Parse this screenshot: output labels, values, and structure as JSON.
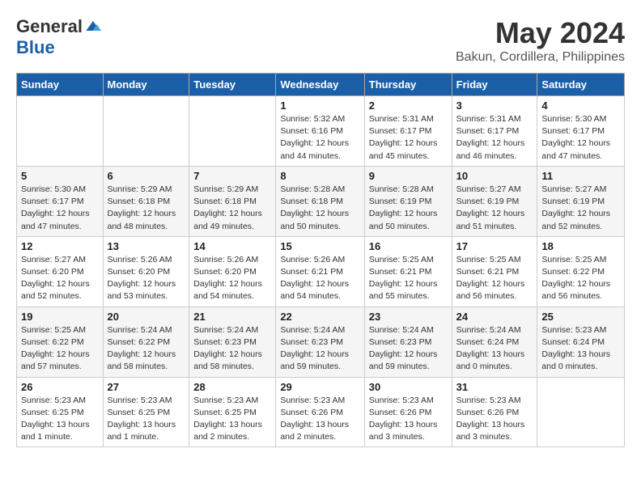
{
  "header": {
    "logo_general": "General",
    "logo_blue": "Blue",
    "title": "May 2024",
    "location": "Bakun, Cordillera, Philippines"
  },
  "weekdays": [
    "Sunday",
    "Monday",
    "Tuesday",
    "Wednesday",
    "Thursday",
    "Friday",
    "Saturday"
  ],
  "weeks": [
    [
      {
        "day": "",
        "info": ""
      },
      {
        "day": "",
        "info": ""
      },
      {
        "day": "",
        "info": ""
      },
      {
        "day": "1",
        "info": "Sunrise: 5:32 AM\nSunset: 6:16 PM\nDaylight: 12 hours\nand 44 minutes."
      },
      {
        "day": "2",
        "info": "Sunrise: 5:31 AM\nSunset: 6:17 PM\nDaylight: 12 hours\nand 45 minutes."
      },
      {
        "day": "3",
        "info": "Sunrise: 5:31 AM\nSunset: 6:17 PM\nDaylight: 12 hours\nand 46 minutes."
      },
      {
        "day": "4",
        "info": "Sunrise: 5:30 AM\nSunset: 6:17 PM\nDaylight: 12 hours\nand 47 minutes."
      }
    ],
    [
      {
        "day": "5",
        "info": "Sunrise: 5:30 AM\nSunset: 6:17 PM\nDaylight: 12 hours\nand 47 minutes."
      },
      {
        "day": "6",
        "info": "Sunrise: 5:29 AM\nSunset: 6:18 PM\nDaylight: 12 hours\nand 48 minutes."
      },
      {
        "day": "7",
        "info": "Sunrise: 5:29 AM\nSunset: 6:18 PM\nDaylight: 12 hours\nand 49 minutes."
      },
      {
        "day": "8",
        "info": "Sunrise: 5:28 AM\nSunset: 6:18 PM\nDaylight: 12 hours\nand 50 minutes."
      },
      {
        "day": "9",
        "info": "Sunrise: 5:28 AM\nSunset: 6:19 PM\nDaylight: 12 hours\nand 50 minutes."
      },
      {
        "day": "10",
        "info": "Sunrise: 5:27 AM\nSunset: 6:19 PM\nDaylight: 12 hours\nand 51 minutes."
      },
      {
        "day": "11",
        "info": "Sunrise: 5:27 AM\nSunset: 6:19 PM\nDaylight: 12 hours\nand 52 minutes."
      }
    ],
    [
      {
        "day": "12",
        "info": "Sunrise: 5:27 AM\nSunset: 6:20 PM\nDaylight: 12 hours\nand 52 minutes."
      },
      {
        "day": "13",
        "info": "Sunrise: 5:26 AM\nSunset: 6:20 PM\nDaylight: 12 hours\nand 53 minutes."
      },
      {
        "day": "14",
        "info": "Sunrise: 5:26 AM\nSunset: 6:20 PM\nDaylight: 12 hours\nand 54 minutes."
      },
      {
        "day": "15",
        "info": "Sunrise: 5:26 AM\nSunset: 6:21 PM\nDaylight: 12 hours\nand 54 minutes."
      },
      {
        "day": "16",
        "info": "Sunrise: 5:25 AM\nSunset: 6:21 PM\nDaylight: 12 hours\nand 55 minutes."
      },
      {
        "day": "17",
        "info": "Sunrise: 5:25 AM\nSunset: 6:21 PM\nDaylight: 12 hours\nand 56 minutes."
      },
      {
        "day": "18",
        "info": "Sunrise: 5:25 AM\nSunset: 6:22 PM\nDaylight: 12 hours\nand 56 minutes."
      }
    ],
    [
      {
        "day": "19",
        "info": "Sunrise: 5:25 AM\nSunset: 6:22 PM\nDaylight: 12 hours\nand 57 minutes."
      },
      {
        "day": "20",
        "info": "Sunrise: 5:24 AM\nSunset: 6:22 PM\nDaylight: 12 hours\nand 58 minutes."
      },
      {
        "day": "21",
        "info": "Sunrise: 5:24 AM\nSunset: 6:23 PM\nDaylight: 12 hours\nand 58 minutes."
      },
      {
        "day": "22",
        "info": "Sunrise: 5:24 AM\nSunset: 6:23 PM\nDaylight: 12 hours\nand 59 minutes."
      },
      {
        "day": "23",
        "info": "Sunrise: 5:24 AM\nSunset: 6:23 PM\nDaylight: 12 hours\nand 59 minutes."
      },
      {
        "day": "24",
        "info": "Sunrise: 5:24 AM\nSunset: 6:24 PM\nDaylight: 13 hours\nand 0 minutes."
      },
      {
        "day": "25",
        "info": "Sunrise: 5:23 AM\nSunset: 6:24 PM\nDaylight: 13 hours\nand 0 minutes."
      }
    ],
    [
      {
        "day": "26",
        "info": "Sunrise: 5:23 AM\nSunset: 6:25 PM\nDaylight: 13 hours\nand 1 minute."
      },
      {
        "day": "27",
        "info": "Sunrise: 5:23 AM\nSunset: 6:25 PM\nDaylight: 13 hours\nand 1 minute."
      },
      {
        "day": "28",
        "info": "Sunrise: 5:23 AM\nSunset: 6:25 PM\nDaylight: 13 hours\nand 2 minutes."
      },
      {
        "day": "29",
        "info": "Sunrise: 5:23 AM\nSunset: 6:26 PM\nDaylight: 13 hours\nand 2 minutes."
      },
      {
        "day": "30",
        "info": "Sunrise: 5:23 AM\nSunset: 6:26 PM\nDaylight: 13 hours\nand 3 minutes."
      },
      {
        "day": "31",
        "info": "Sunrise: 5:23 AM\nSunset: 6:26 PM\nDaylight: 13 hours\nand 3 minutes."
      },
      {
        "day": "",
        "info": ""
      }
    ]
  ]
}
